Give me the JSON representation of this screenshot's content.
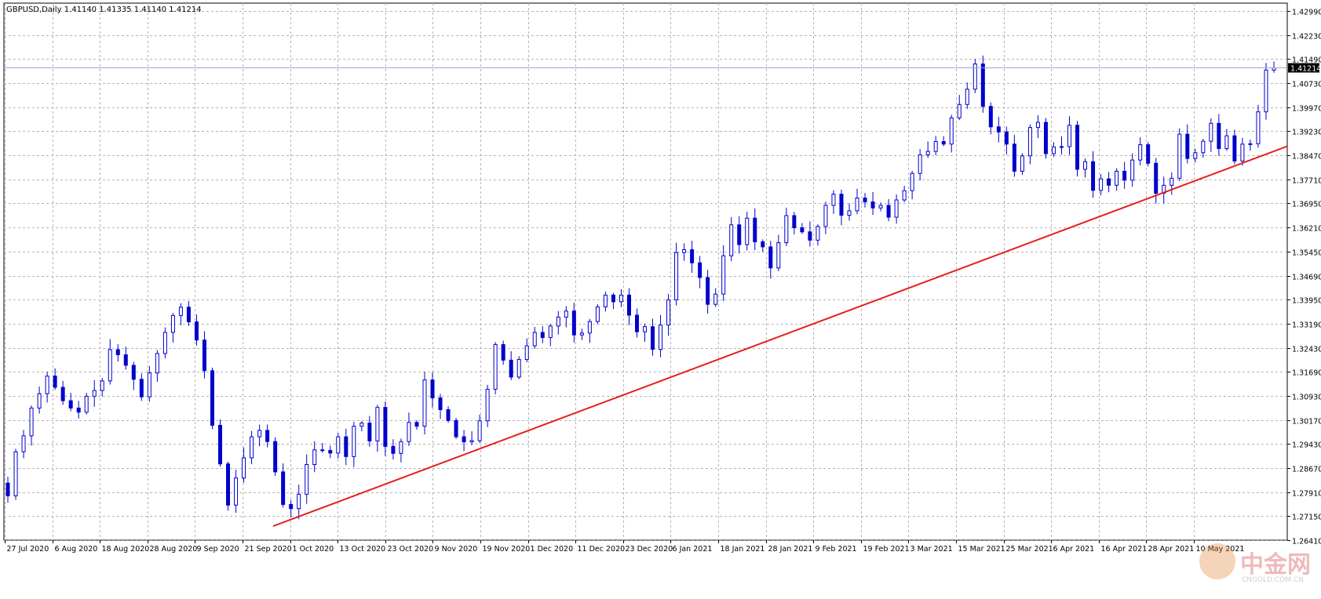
{
  "header": {
    "symbol": "GBPUSD,Daily",
    "ohlc": "1.41140 1.41335 1.41140 1.41214"
  },
  "watermark": {
    "brand": "中金网",
    "site": "CNGOLD.COM.CN"
  },
  "colors": {
    "candle": "#0000cc",
    "grid": "#b4b4b4",
    "trendline": "#e61e1e",
    "current_line": "#9aa6d8",
    "price_tag_bg": "#000000"
  },
  "chart_data": {
    "type": "candlestick",
    "symbol": "GBPUSD",
    "timeframe": "Daily",
    "current_price": 1.41214,
    "ylim": [
      1.2641,
      1.4299
    ],
    "y_ticks": [
      "1.42990",
      "1.42230",
      "1.41490",
      "1.40730",
      "1.39970",
      "1.39230",
      "1.38470",
      "1.37710",
      "1.36950",
      "1.36210",
      "1.35450",
      "1.34690",
      "1.33950",
      "1.33190",
      "1.32430",
      "1.31690",
      "1.30930",
      "1.30170",
      "1.29430",
      "1.28670",
      "1.27910",
      "1.27150",
      "1.26410"
    ],
    "x_labels": [
      "27 Jul 2020",
      "6 Aug 2020",
      "18 Aug 2020",
      "28 Aug 2020",
      "9 Sep 2020",
      "21 Sep 2020",
      "1 Oct 2020",
      "13 Oct 2020",
      "23 Oct 2020",
      "9 Nov 2020",
      "19 Nov 2020",
      "1 Dec 2020",
      "11 Dec 2020",
      "23 Dec 2020",
      "6 Jan 2021",
      "18 Jan 2021",
      "28 Jan 2021",
      "9 Feb 2021",
      "19 Feb 2021",
      "3 Mar 2021",
      "15 Mar 2021",
      "25 Mar 2021",
      "6 Apr 2021",
      "16 Apr 2021",
      "28 Apr 2021",
      "10 May 2021"
    ],
    "closes": [
      1.278,
      1.2918,
      1.2968,
      1.3055,
      1.31,
      1.3155,
      1.312,
      1.3078,
      1.3055,
      1.3042,
      1.3092,
      1.311,
      1.314,
      1.3238,
      1.3222,
      1.3189,
      1.3145,
      1.309,
      1.3165,
      1.3226,
      1.3292,
      1.3345,
      1.3371,
      1.3325,
      1.3268,
      1.3172,
      1.3001,
      1.288,
      1.2751,
      1.2836,
      1.2899,
      1.2965,
      1.2985,
      1.295,
      1.2855,
      1.2753,
      1.274,
      1.2785,
      1.2878,
      1.2924,
      1.2922,
      1.2914,
      1.2965,
      1.2903,
      1.2998,
      1.3008,
      1.2952,
      1.3057,
      1.2935,
      1.2913,
      1.295,
      1.301,
      1.2998,
      1.3143,
      1.3087,
      1.305,
      1.3016,
      1.2965,
      1.2949,
      1.2953,
      1.3015,
      1.3114,
      1.3254,
      1.3205,
      1.3152,
      1.3207,
      1.325,
      1.3292,
      1.3276,
      1.3312,
      1.334,
      1.3359,
      1.3284,
      1.329,
      1.3326,
      1.3372,
      1.3409,
      1.3388,
      1.3409,
      1.3346,
      1.3294,
      1.331,
      1.3239,
      1.3315,
      1.3394,
      1.3542,
      1.3551,
      1.351,
      1.3464,
      1.338,
      1.3412,
      1.3532,
      1.3629,
      1.3567,
      1.365,
      1.3576,
      1.356,
      1.3494,
      1.3573,
      1.3658,
      1.362,
      1.3607,
      1.3581,
      1.3624,
      1.369,
      1.3725,
      1.3659,
      1.3673,
      1.3713,
      1.3701,
      1.3682,
      1.369,
      1.3653,
      1.3707,
      1.3736,
      1.379,
      1.3848,
      1.3859,
      1.389,
      1.3882,
      1.3964,
      1.4006,
      1.4054,
      1.4133,
      1.4,
      1.3936,
      1.392,
      1.3882,
      1.3797,
      1.3845,
      1.3934,
      1.395,
      1.3852,
      1.3873,
      1.3874,
      1.3941,
      1.3803,
      1.3827,
      1.3737,
      1.3773,
      1.3753,
      1.3797,
      1.3769,
      1.3832,
      1.388,
      1.3822,
      1.3728,
      1.3753,
      1.3775,
      1.3913,
      1.3837,
      1.3855,
      1.3891,
      1.3947,
      1.3868,
      1.3908,
      1.3829,
      1.3882,
      1.3883,
      1.3983,
      1.4114,
      1.4121
    ]
  }
}
